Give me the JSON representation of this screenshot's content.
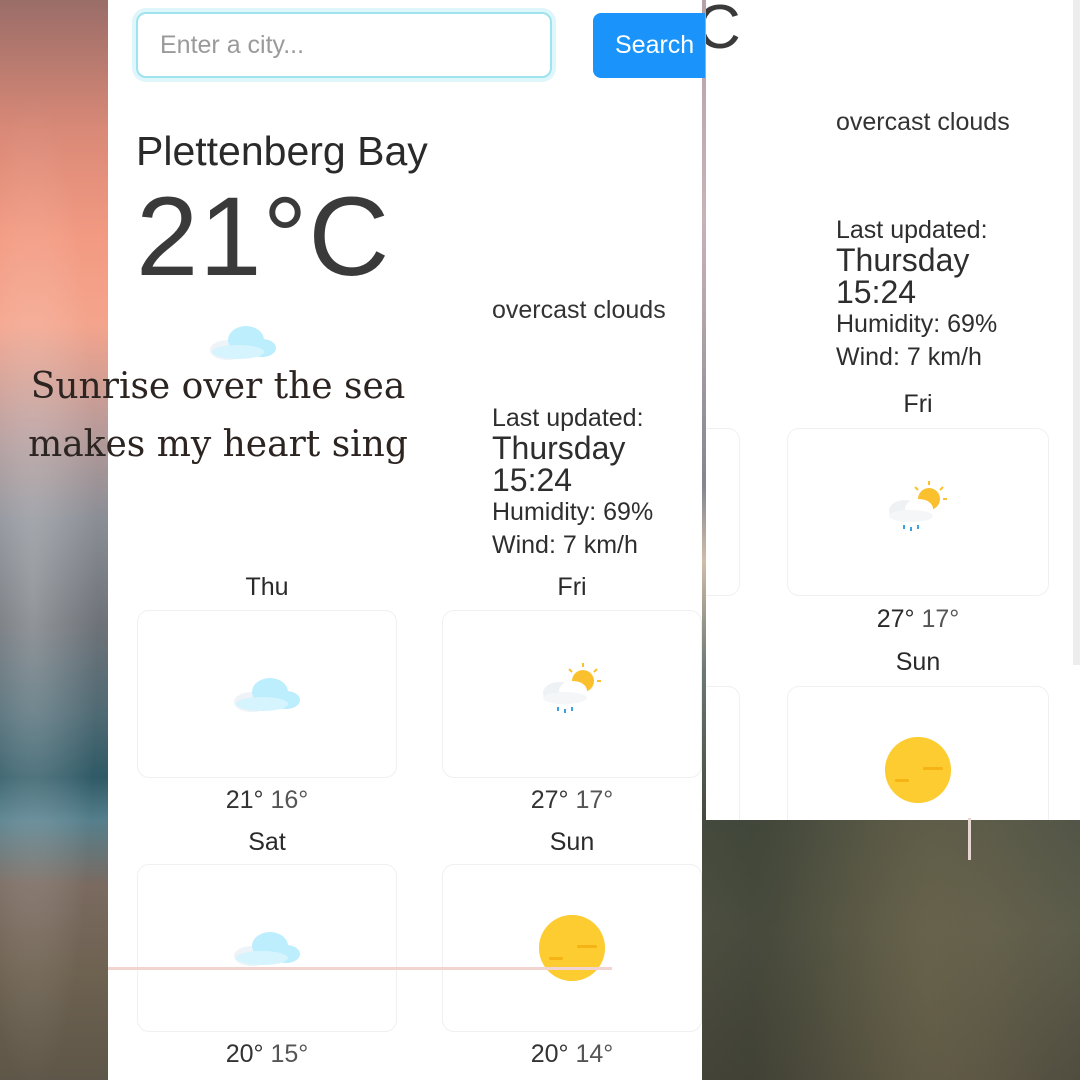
{
  "search": {
    "placeholder": "Enter a city...",
    "button_label": "Search"
  },
  "current": {
    "city": "Plettenberg Bay",
    "temperature": "21°C",
    "description": "overcast clouds",
    "icon": "cloud-icon",
    "updated_label": "Last updated:",
    "updated_day": "Thursday",
    "updated_time": "15:24",
    "humidity": "Humidity: 69%",
    "wind": "Wind: 7 km/h"
  },
  "forecast": [
    {
      "day": "Thu",
      "icon": "cloud-icon",
      "high": "21°",
      "low": "16°"
    },
    {
      "day": "Fri",
      "icon": "sun-cloud-rain-icon",
      "high": "27°",
      "low": "17°"
    },
    {
      "day": "Sat",
      "icon": "cloud-icon",
      "high": "20°",
      "low": "15°"
    },
    {
      "day": "Sun",
      "icon": "sun-icon",
      "high": "20°",
      "low": "14°"
    }
  ],
  "overlay": {
    "line1": "Sunrise over the sea",
    "line2": "makes my heart sing"
  },
  "right_panel": {
    "temp_fragment": "C",
    "description": "overcast clouds",
    "updated_label": "Last updated:",
    "updated_day": "Thursday",
    "updated_time": "15:24",
    "humidity": "Humidity: 69%",
    "wind": "Wind: 7 km/h",
    "forecast": [
      {
        "day": "Fri",
        "icon": "sun-cloud-rain-icon",
        "high": "27°",
        "low": "17°"
      },
      {
        "day": "Sun",
        "icon": "sun-icon"
      }
    ]
  },
  "colors": {
    "accent": "#1a94fb",
    "input_border": "#9fe3ef",
    "sun": "#fbc02d",
    "cloud": "#bdeefe"
  }
}
